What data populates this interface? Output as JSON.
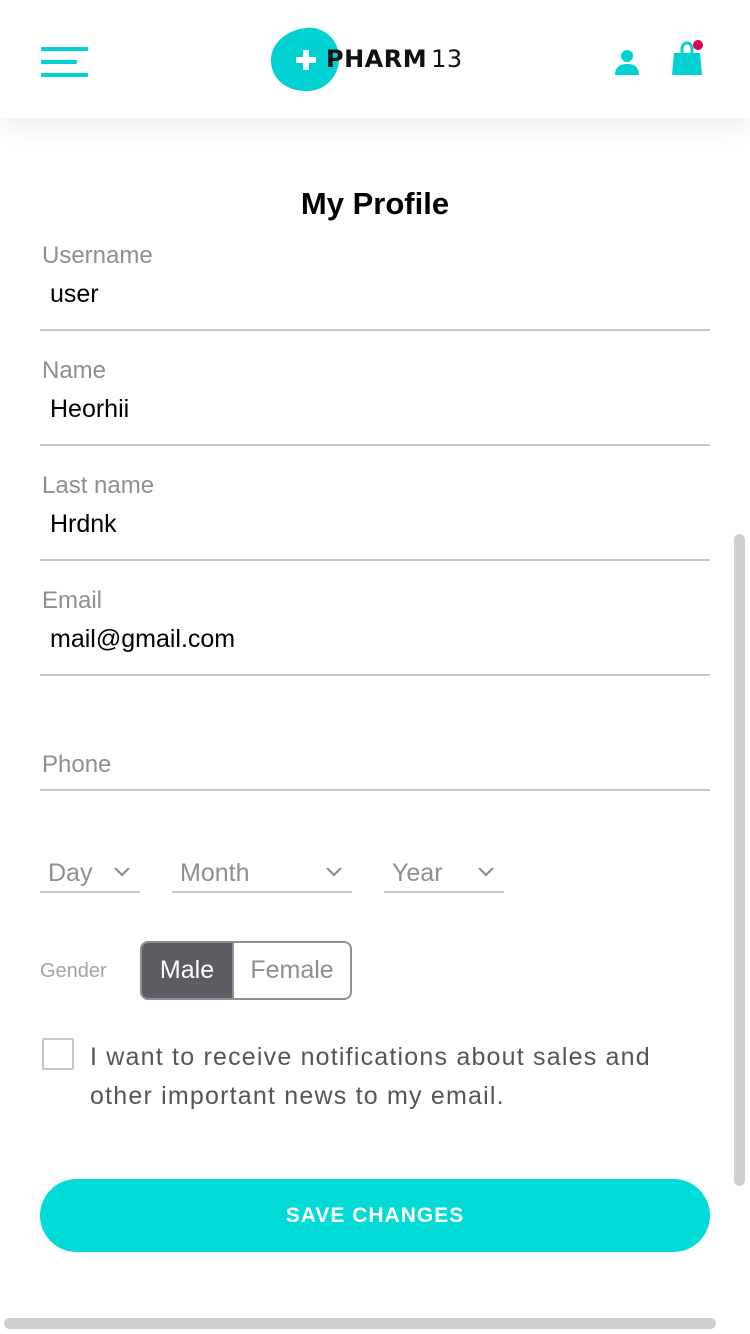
{
  "header": {
    "logo": {
      "brand": "PHARM",
      "number": "13"
    },
    "accent_color": "#00d1d3",
    "cart_badge_color": "#d6005f"
  },
  "page": {
    "title": "My Profile"
  },
  "form": {
    "username": {
      "label": "Username",
      "value": "user"
    },
    "name": {
      "label": "Name",
      "value": "Heorhii"
    },
    "last_name": {
      "label": "Last name",
      "value": "Hrdnk"
    },
    "email": {
      "label": "Email",
      "value": "mail@gmail.com"
    },
    "phone": {
      "label": "Phone",
      "value": ""
    },
    "birth": {
      "day": "Day",
      "month": "Month",
      "year": "Year"
    },
    "gender": {
      "label": "Gender",
      "options": [
        "Male",
        "Female"
      ],
      "selected": "Male"
    },
    "notifications": {
      "text": "I want to receive notifications about sales and other important news to my email.",
      "checked": false
    },
    "save_label": "SAVE CHANGES"
  },
  "icons": {
    "menu": "hamburger-menu-icon",
    "user": "user-icon",
    "cart": "shopping-bag-icon",
    "chevron": "chevron-down-icon"
  }
}
